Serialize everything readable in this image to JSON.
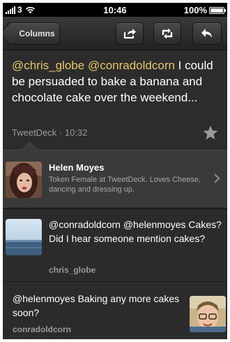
{
  "status_bar": {
    "carrier": "3",
    "time": "10:46",
    "battery": "100%"
  },
  "toolbar": {
    "back_label": "Columns",
    "share_icon": "share-icon",
    "retweet_icon": "retweet-icon",
    "reply_icon": "reply-icon"
  },
  "tweet": {
    "mention1": "@chris_globe",
    "mention2": "@conradoldcorn",
    "body": " I could be persuaded to bake a banana and chocolate cake over the weekend...",
    "source": "TweetDeck",
    "separator": "·",
    "time": "10:32",
    "favorite_icon": "star-icon"
  },
  "author": {
    "name": "Helen Moyes",
    "bio": "Token Female at TweetDeck. Loves Cheese, dancing and dressing up."
  },
  "replies": [
    {
      "text": "@conradoldcorn @helenmoyes Cakes? Did I hear someone mention cakes?",
      "username": "chris_globe"
    },
    {
      "text": "@helenmoyes Baking any more cakes soon?",
      "username": "conradoldcorn"
    }
  ],
  "colors": {
    "mention": "#e8c66a",
    "background": "#2b2b2b",
    "profile_row": "#3a3a3a"
  }
}
